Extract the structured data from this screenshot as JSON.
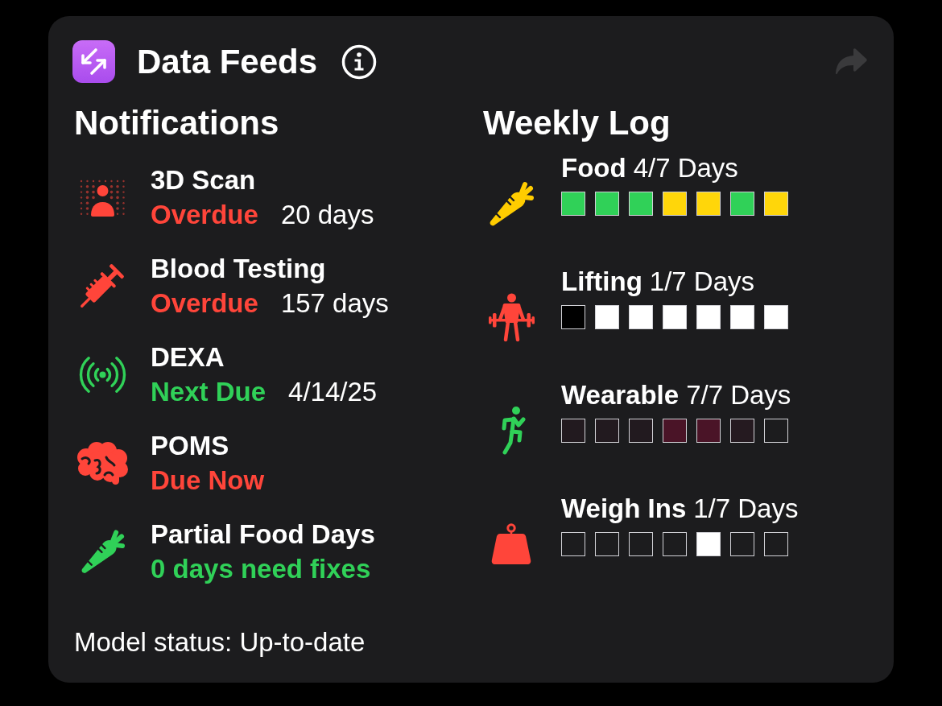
{
  "header": {
    "title": "Data Feeds",
    "forward_button": {
      "disabled": true
    }
  },
  "notifications": {
    "heading": "Notifications",
    "items": [
      {
        "title": "3D Scan",
        "status": "Overdue",
        "detail": "20 days",
        "color": "#ff453a"
      },
      {
        "title": "Blood Testing",
        "status": "Overdue",
        "detail": "157 days",
        "color": "#ff453a"
      },
      {
        "title": "DEXA",
        "status": "Next Due",
        "detail": "4/14/25",
        "color": "#30d158"
      },
      {
        "title": "POMS",
        "status": "Due Now",
        "color": "#ff453a"
      },
      {
        "title": "Partial Food Days",
        "status": "0 days need fixes",
        "color": "#30d158"
      }
    ]
  },
  "weekly_log": {
    "heading": "Weekly Log",
    "items": [
      {
        "name": "Food",
        "count": "4/7 Days",
        "color": "#ffcc00",
        "days": [
          {
            "color": "#30d158"
          },
          {
            "color": "#30d158"
          },
          {
            "color": "#30d158"
          },
          {
            "color": "#ffd60a"
          },
          {
            "color": "#ffd60a"
          },
          {
            "color": "#30d158"
          },
          {
            "color": "#ffd60a"
          }
        ]
      },
      {
        "name": "Lifting",
        "count": "1/7 Days",
        "color": "#ff453a",
        "days": [
          {
            "color": "#000000"
          },
          {
            "color": "#ffffff"
          },
          {
            "color": "#ffffff"
          },
          {
            "color": "#ffffff"
          },
          {
            "color": "#ffffff"
          },
          {
            "color": "#ffffff"
          },
          {
            "color": "#ffffff"
          }
        ]
      },
      {
        "name": "Wearable",
        "count": "7/7 Days",
        "color": "#30d158",
        "days": [
          {
            "color": "#221a1f"
          },
          {
            "color": "#221a1f"
          },
          {
            "color": "#221a1f"
          },
          {
            "color": "#4a1427"
          },
          {
            "color": "#4a1427"
          },
          {
            "color": "#251a20"
          },
          {
            "color": "#1c1c1e"
          }
        ]
      },
      {
        "name": "Weigh Ins",
        "count": "1/7 Days",
        "color": "#ff453a",
        "days": [
          {
            "color": "#1c1c1e"
          },
          {
            "color": "#1c1c1e"
          },
          {
            "color": "#1c1c1e"
          },
          {
            "color": "#1c1c1e"
          },
          {
            "color": "#ffffff"
          },
          {
            "color": "#1c1c1e"
          },
          {
            "color": "#1c1c1e"
          }
        ]
      }
    ]
  },
  "footer": {
    "status": "Model status: Up-to-date"
  }
}
